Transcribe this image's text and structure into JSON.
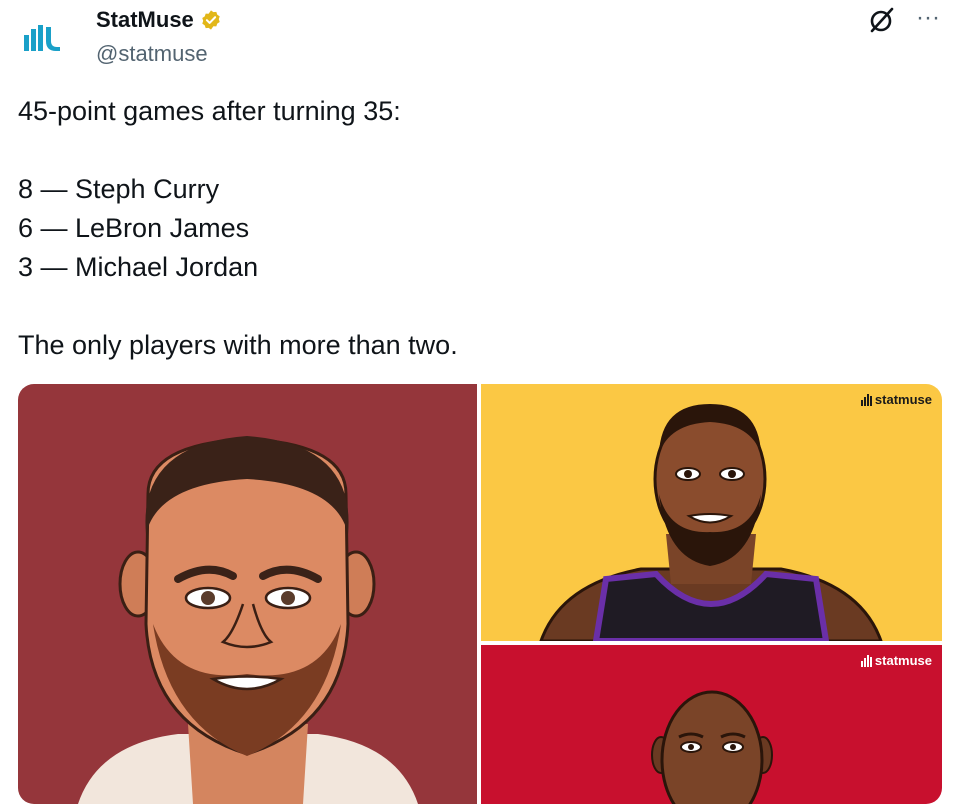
{
  "account": {
    "display_name": "StatMuse",
    "handle": "@statmuse",
    "avatar_icon": "statmuse-logo",
    "verified_badge_color": "#e2b719"
  },
  "actions": {
    "grok_icon": "grok-icon",
    "more_label": "···"
  },
  "tweet": {
    "line1": "45-point games after turning 35:",
    "line2": "8 — Steph Curry",
    "line3": "6 — LeBron James",
    "line4": "3 — Michael Jordan",
    "line5": "The only players with more than two."
  },
  "media": {
    "panel1": {
      "subject": "Steph Curry illustration",
      "bg": "#95363b"
    },
    "panel2": {
      "subject": "LeBron James illustration",
      "bg": "#fbc844",
      "watermark": "statmuse"
    },
    "panel3": {
      "subject": "Michael Jordan illustration",
      "bg": "#c8102e",
      "watermark": "statmuse"
    }
  }
}
